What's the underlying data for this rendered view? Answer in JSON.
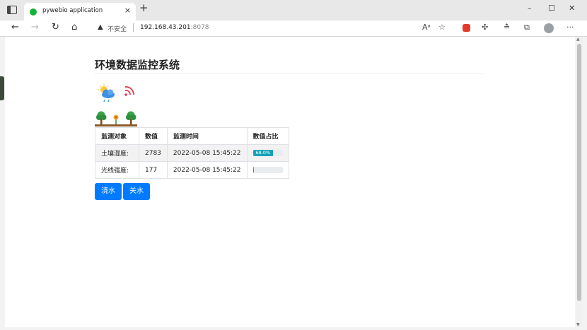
{
  "browser": {
    "tab_title": "pywebio application",
    "tab_close": "×",
    "new_tab": "+",
    "window_controls": {
      "minimize": "–",
      "maximize": "☐",
      "close": "✕"
    },
    "nav": {
      "back": "←",
      "forward": "→",
      "reload": "↻",
      "home": "⌂"
    },
    "security_label": "不安全",
    "url_host": "192.168.43.201",
    "url_port": ":8078",
    "more_menu": "···",
    "accent_color": "#17b338"
  },
  "page": {
    "title": "环境数据监控系统",
    "icons": [
      "weather-icon",
      "wifi-icon",
      "garden-icon"
    ],
    "table": {
      "headers": [
        "监测对象",
        "数值",
        "监测时间",
        "数值占比"
      ],
      "rows": [
        {
          "object": "土壤湿度:",
          "value": "2783",
          "time": "2022-05-08 15:45:22",
          "percent": 0.68,
          "percent_label": "68.0%"
        },
        {
          "object": "光线强度:",
          "value": "177",
          "time": "2022-05-08 15:45:22",
          "percent": 0.04,
          "percent_label": ""
        }
      ]
    },
    "buttons": {
      "water": "浇水",
      "stop_water": "关水"
    },
    "button_color": "#007bff",
    "progress_color": "#17a2b8"
  }
}
